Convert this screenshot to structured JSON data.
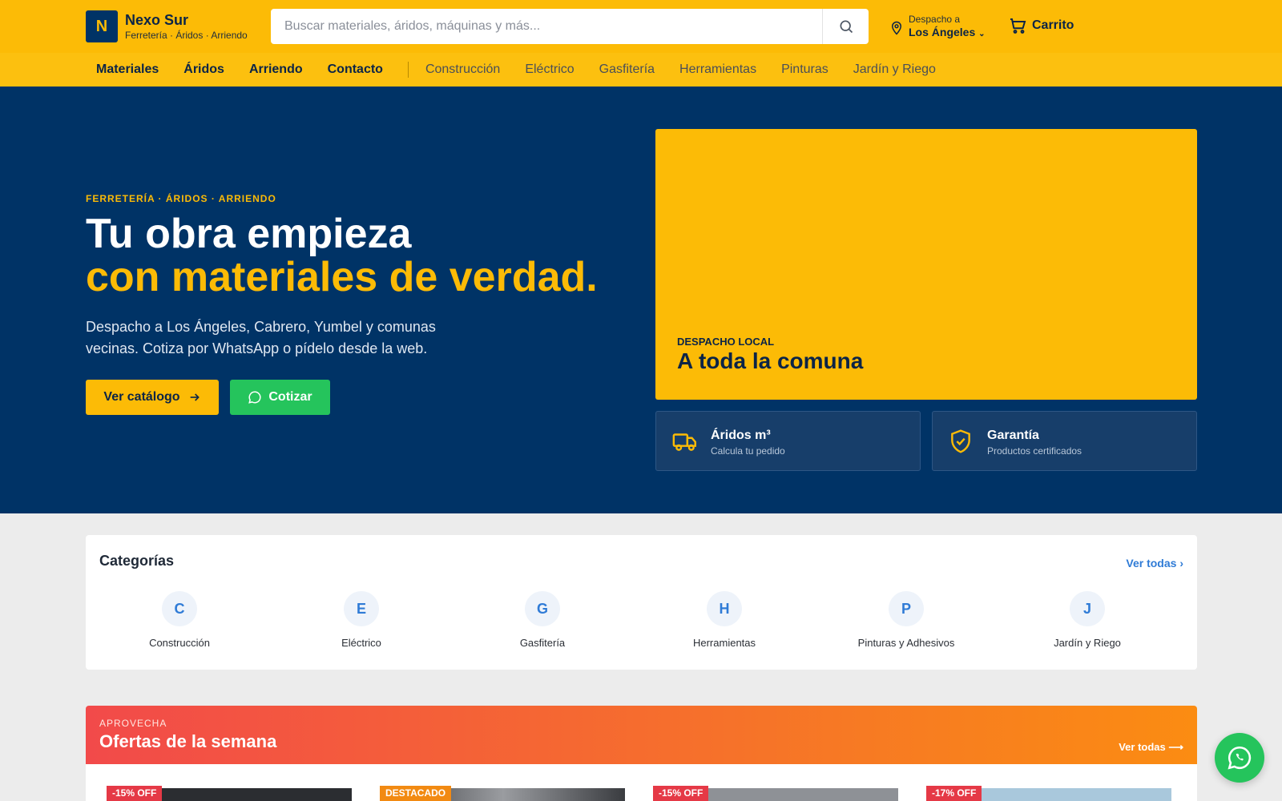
{
  "brand": {
    "logo_letter": "N",
    "name": "Nexo Sur",
    "tagline": "Ferretería · Áridos · Arriendo"
  },
  "search": {
    "placeholder": "Buscar materiales, áridos, máquinas y más...",
    "icon": "search-icon"
  },
  "location": {
    "label": "Despacho a",
    "city": "Los Ángeles",
    "icon": "map-pin-icon"
  },
  "cart": {
    "label": "Carrito",
    "icon": "cart-icon"
  },
  "nav": {
    "main": [
      "Materiales",
      "Áridos",
      "Arriendo",
      "Contacto"
    ],
    "categories": [
      "Construcción",
      "Eléctrico",
      "Gasfitería",
      "Herramientas",
      "Pinturas",
      "Jardín y Riego"
    ]
  },
  "hero": {
    "eyebrow": "FERRETERÍA · ÁRIDOS · ARRIENDO",
    "title_line1": "Tu obra empieza",
    "title_line2": "con materiales de verdad.",
    "lead": "Despacho a Los Ángeles, Cabrero, Yumbel y comunas vecinas. Cotiza por WhatsApp o pídelo desde la web.",
    "btn_catalog": "Ver catálogo",
    "btn_quote": "Cotizar",
    "promo_tag": "DESPACHO LOCAL",
    "promo_title": "A toda la comuna",
    "features": [
      {
        "title": "Áridos m³",
        "subtitle": "Calcula tu pedido",
        "icon": "truck-icon"
      },
      {
        "title": "Garantía",
        "subtitle": "Productos certificados",
        "icon": "shield-check-icon"
      }
    ]
  },
  "categories": {
    "title": "Categorías",
    "view_all": "Ver todas",
    "items": [
      {
        "letter": "C",
        "label": "Construcción"
      },
      {
        "letter": "E",
        "label": "Eléctrico"
      },
      {
        "letter": "G",
        "label": "Gasfitería"
      },
      {
        "letter": "H",
        "label": "Herramientas"
      },
      {
        "letter": "P",
        "label": "Pinturas y Adhesivos"
      },
      {
        "letter": "J",
        "label": "Jardín y Riego"
      }
    ]
  },
  "offers": {
    "tag": "APROVECHA",
    "title": "Ofertas de la semana",
    "view_all": "Ver todas ⟶",
    "badges": [
      "-15% OFF",
      "DESTACADO",
      "-15% OFF",
      "-17% OFF"
    ]
  },
  "colors": {
    "primary": "#fcbb06",
    "navy": "#003366",
    "whatsapp": "#25c45c",
    "link": "#2f7bd6",
    "sale": "#e53946"
  }
}
